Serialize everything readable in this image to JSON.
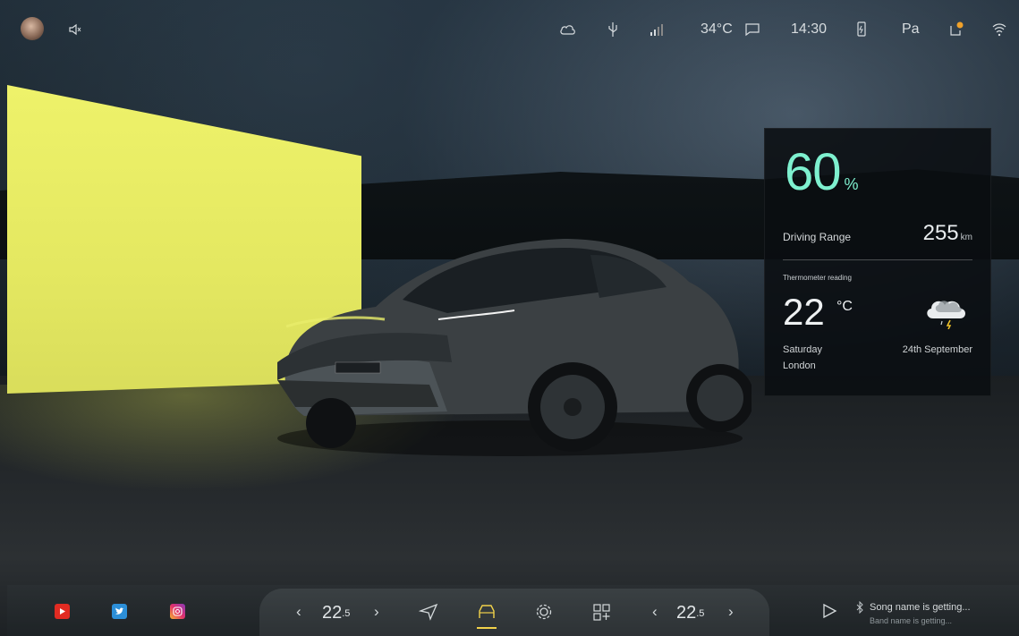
{
  "status_bar": {
    "temperature": "34°C",
    "time": "14:30",
    "seat_label": "Pa"
  },
  "info_card": {
    "battery_value": "60",
    "battery_unit": "%",
    "range_label": "Driving Range",
    "range_value": "255",
    "range_unit": "km",
    "temp_caption": "Thermometer reading",
    "temp_value": "22",
    "temp_unit": "°C",
    "day": "Saturday",
    "city": "London",
    "date": "24th September"
  },
  "dock": {
    "left_temp_value": "22",
    "left_temp_decimal": ".5",
    "right_temp_value": "22",
    "right_temp_decimal": ".5",
    "song_title": "Song name is getting...",
    "band_name": "Band name is getting..."
  },
  "colors": {
    "accent_teal": "#7ef0cf",
    "active_yellow": "#f1d24a"
  },
  "icons": [
    "avatar",
    "mute-icon",
    "cloud-icon",
    "usb-icon",
    "signal-icon",
    "message-icon",
    "phone-charge-icon",
    "seat-heat-icon",
    "notification-icon",
    "wifi-icon",
    "youtube-icon",
    "twitter-icon",
    "instagram-icon",
    "navigation-icon",
    "car-icon",
    "settings-icon",
    "add-app-icon",
    "play-icon",
    "bluetooth-icon",
    "weather-storm-icon"
  ]
}
